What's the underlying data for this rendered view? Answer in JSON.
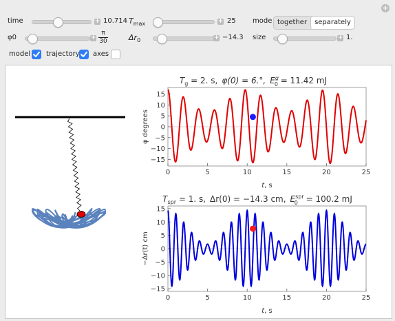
{
  "corner_icon": "plus-circle-icon",
  "controls": {
    "time": {
      "label": "time",
      "value": "10.714",
      "fraction": 0.43
    },
    "tmax": {
      "label": "T",
      "label_sub": "max",
      "value": "25",
      "fraction": 0.0
    },
    "phi0": {
      "label": "φ0",
      "value_num": "π",
      "value_den": "30",
      "fraction": 0.05
    },
    "dr0": {
      "label": "Δr",
      "label_sub": "0",
      "value": "−14.3",
      "fraction": 0.08
    },
    "size": {
      "label": "size",
      "value": "1.",
      "fraction": 0.08
    },
    "mode": {
      "label": "mode",
      "options": [
        "together",
        "separately"
      ],
      "selected": "separately"
    },
    "checkboxes": [
      {
        "label": "model",
        "checked": true
      },
      {
        "label": "trajectory",
        "checked": true
      },
      {
        "label": "axes",
        "checked": false
      }
    ]
  },
  "plot1": {
    "title_a": "T",
    "title_a_sub": "g",
    "title_a_rest": " = 2. s,",
    "title_b": "φ(0) = 6.°,",
    "title_c": "E",
    "title_c_sup": "g",
    "title_c_sub": "0",
    "title_c_rest": " = 11.42 mJ",
    "ylabel": "φ degrees",
    "xlabel_var": "t",
    "xlabel_unit": ", s",
    "xticks": [
      "0",
      "5",
      "10",
      "15",
      "20",
      "25"
    ],
    "yticks": [
      "15",
      "10",
      "5",
      "0",
      "−5",
      "−10",
      "−15"
    ],
    "line_color": "#e00000",
    "marker_color": "#1a1aff"
  },
  "plot2": {
    "title_a": "T",
    "title_a_sub": "spr",
    "title_a_rest": " = 1. s,",
    "title_b": "Δr(0) = −14.3 cm,",
    "title_c": "E",
    "title_c_sup": "spr",
    "title_c_sub": "0",
    "title_c_rest": " = 100.2 mJ",
    "ylabel": "−Δr(t) cm",
    "xlabel_var": "t",
    "xlabel_unit": ", s",
    "xticks": [
      "0",
      "5",
      "10",
      "15",
      "20",
      "25"
    ],
    "yticks": [
      "15",
      "10",
      "5",
      "0",
      "−5",
      "−10",
      "−15"
    ],
    "line_color": "#0000dd",
    "marker_color": "#ff1a1a"
  },
  "chart_data": [
    {
      "type": "line",
      "title": "Tg = 2. s, φ(0) = 6.°, E0g = 11.42 mJ",
      "xlabel": "t, s",
      "ylabel": "φ degrees",
      "xlim": [
        0,
        25
      ],
      "ylim": [
        -18,
        18
      ],
      "series": [
        {
          "amplitude": 12,
          "envelope_amplitude": 5,
          "beat_period": 10.0,
          "period": 1.95
        }
      ],
      "marker": {
        "x": 10.714,
        "y": 4.5
      }
    },
    {
      "type": "line",
      "title": "Tspr = 1. s, Δr(0) = −14.3 cm, E0spr = 100.2 mJ",
      "xlabel": "t, s",
      "ylabel": "−Δr(t) cm",
      "xlim": [
        0,
        25
      ],
      "ylim": [
        -16,
        16
      ],
      "series": [
        {
          "amplitude": 8,
          "envelope_amplitude": 6.3,
          "beat_period": 10.0,
          "period": 1.0
        }
      ],
      "marker": {
        "x": 10.714,
        "y": 7.5
      }
    }
  ]
}
